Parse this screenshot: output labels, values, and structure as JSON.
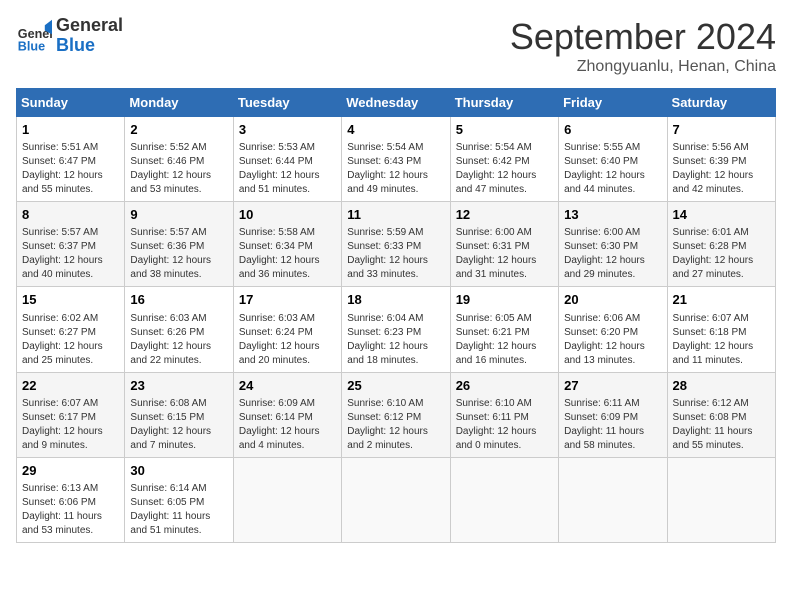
{
  "header": {
    "logo_line1": "General",
    "logo_line2": "Blue",
    "month": "September 2024",
    "location": "Zhongyuanlu, Henan, China"
  },
  "weekdays": [
    "Sunday",
    "Monday",
    "Tuesday",
    "Wednesday",
    "Thursday",
    "Friday",
    "Saturday"
  ],
  "weeks": [
    [
      {
        "day": "1",
        "info": "Sunrise: 5:51 AM\nSunset: 6:47 PM\nDaylight: 12 hours\nand 55 minutes."
      },
      {
        "day": "2",
        "info": "Sunrise: 5:52 AM\nSunset: 6:46 PM\nDaylight: 12 hours\nand 53 minutes."
      },
      {
        "day": "3",
        "info": "Sunrise: 5:53 AM\nSunset: 6:44 PM\nDaylight: 12 hours\nand 51 minutes."
      },
      {
        "day": "4",
        "info": "Sunrise: 5:54 AM\nSunset: 6:43 PM\nDaylight: 12 hours\nand 49 minutes."
      },
      {
        "day": "5",
        "info": "Sunrise: 5:54 AM\nSunset: 6:42 PM\nDaylight: 12 hours\nand 47 minutes."
      },
      {
        "day": "6",
        "info": "Sunrise: 5:55 AM\nSunset: 6:40 PM\nDaylight: 12 hours\nand 44 minutes."
      },
      {
        "day": "7",
        "info": "Sunrise: 5:56 AM\nSunset: 6:39 PM\nDaylight: 12 hours\nand 42 minutes."
      }
    ],
    [
      {
        "day": "8",
        "info": "Sunrise: 5:57 AM\nSunset: 6:37 PM\nDaylight: 12 hours\nand 40 minutes."
      },
      {
        "day": "9",
        "info": "Sunrise: 5:57 AM\nSunset: 6:36 PM\nDaylight: 12 hours\nand 38 minutes."
      },
      {
        "day": "10",
        "info": "Sunrise: 5:58 AM\nSunset: 6:34 PM\nDaylight: 12 hours\nand 36 minutes."
      },
      {
        "day": "11",
        "info": "Sunrise: 5:59 AM\nSunset: 6:33 PM\nDaylight: 12 hours\nand 33 minutes."
      },
      {
        "day": "12",
        "info": "Sunrise: 6:00 AM\nSunset: 6:31 PM\nDaylight: 12 hours\nand 31 minutes."
      },
      {
        "day": "13",
        "info": "Sunrise: 6:00 AM\nSunset: 6:30 PM\nDaylight: 12 hours\nand 29 minutes."
      },
      {
        "day": "14",
        "info": "Sunrise: 6:01 AM\nSunset: 6:28 PM\nDaylight: 12 hours\nand 27 minutes."
      }
    ],
    [
      {
        "day": "15",
        "info": "Sunrise: 6:02 AM\nSunset: 6:27 PM\nDaylight: 12 hours\nand 25 minutes."
      },
      {
        "day": "16",
        "info": "Sunrise: 6:03 AM\nSunset: 6:26 PM\nDaylight: 12 hours\nand 22 minutes."
      },
      {
        "day": "17",
        "info": "Sunrise: 6:03 AM\nSunset: 6:24 PM\nDaylight: 12 hours\nand 20 minutes."
      },
      {
        "day": "18",
        "info": "Sunrise: 6:04 AM\nSunset: 6:23 PM\nDaylight: 12 hours\nand 18 minutes."
      },
      {
        "day": "19",
        "info": "Sunrise: 6:05 AM\nSunset: 6:21 PM\nDaylight: 12 hours\nand 16 minutes."
      },
      {
        "day": "20",
        "info": "Sunrise: 6:06 AM\nSunset: 6:20 PM\nDaylight: 12 hours\nand 13 minutes."
      },
      {
        "day": "21",
        "info": "Sunrise: 6:07 AM\nSunset: 6:18 PM\nDaylight: 12 hours\nand 11 minutes."
      }
    ],
    [
      {
        "day": "22",
        "info": "Sunrise: 6:07 AM\nSunset: 6:17 PM\nDaylight: 12 hours\nand 9 minutes."
      },
      {
        "day": "23",
        "info": "Sunrise: 6:08 AM\nSunset: 6:15 PM\nDaylight: 12 hours\nand 7 minutes."
      },
      {
        "day": "24",
        "info": "Sunrise: 6:09 AM\nSunset: 6:14 PM\nDaylight: 12 hours\nand 4 minutes."
      },
      {
        "day": "25",
        "info": "Sunrise: 6:10 AM\nSunset: 6:12 PM\nDaylight: 12 hours\nand 2 minutes."
      },
      {
        "day": "26",
        "info": "Sunrise: 6:10 AM\nSunset: 6:11 PM\nDaylight: 12 hours\nand 0 minutes."
      },
      {
        "day": "27",
        "info": "Sunrise: 6:11 AM\nSunset: 6:09 PM\nDaylight: 11 hours\nand 58 minutes."
      },
      {
        "day": "28",
        "info": "Sunrise: 6:12 AM\nSunset: 6:08 PM\nDaylight: 11 hours\nand 55 minutes."
      }
    ],
    [
      {
        "day": "29",
        "info": "Sunrise: 6:13 AM\nSunset: 6:06 PM\nDaylight: 11 hours\nand 53 minutes."
      },
      {
        "day": "30",
        "info": "Sunrise: 6:14 AM\nSunset: 6:05 PM\nDaylight: 11 hours\nand 51 minutes."
      },
      {
        "day": "",
        "info": ""
      },
      {
        "day": "",
        "info": ""
      },
      {
        "day": "",
        "info": ""
      },
      {
        "day": "",
        "info": ""
      },
      {
        "day": "",
        "info": ""
      }
    ]
  ]
}
